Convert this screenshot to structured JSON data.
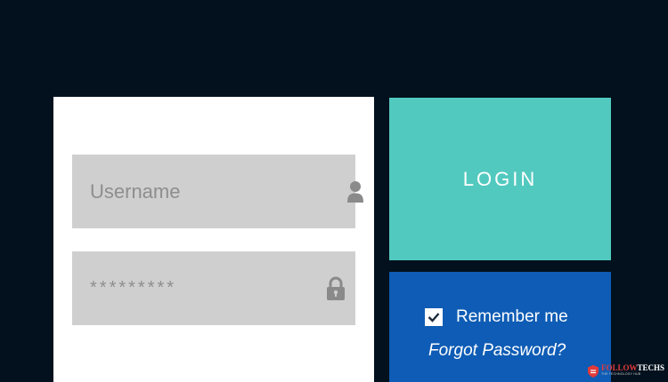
{
  "login_form": {
    "username": {
      "placeholder": "Username",
      "icon": "user-icon"
    },
    "password": {
      "placeholder": "*********",
      "icon": "lock-icon"
    }
  },
  "login_button": {
    "label": "LOGIN"
  },
  "options": {
    "remember_me": {
      "label": "Remember me",
      "checked": true
    },
    "forgot_password": {
      "label": "Forgot Password?"
    }
  },
  "watermark": {
    "brand_prefix": "FOLLOW",
    "brand_suffix": "TECHS",
    "tagline": "THE TECHNOLOGY HUB"
  },
  "colors": {
    "background": "#02111d",
    "login_button": "#52c9bf",
    "options_panel": "#0e5cb5",
    "field": "#cfcfcf"
  }
}
